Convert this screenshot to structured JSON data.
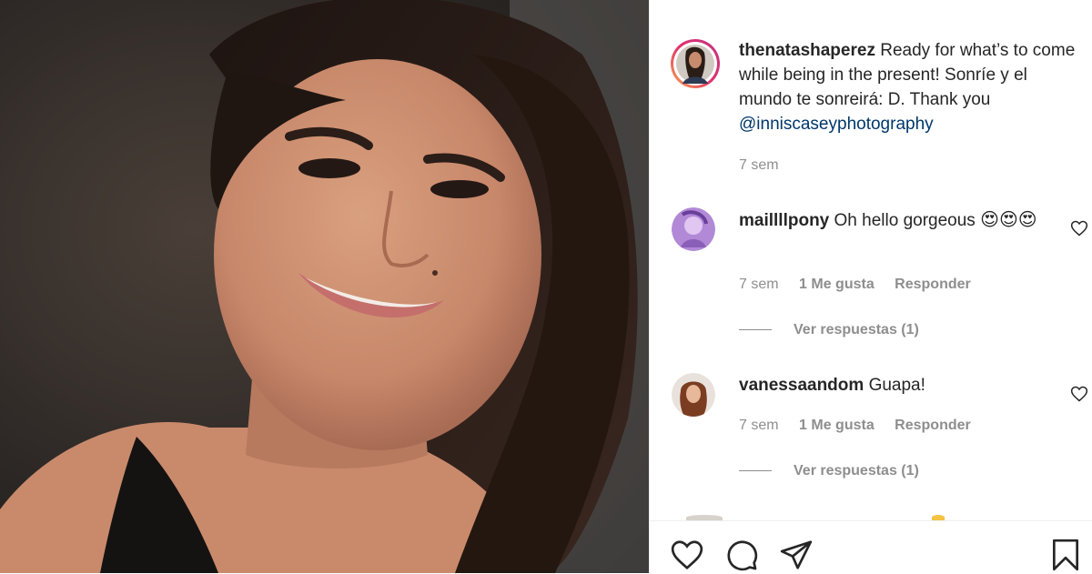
{
  "post": {
    "author": "thenatashaperez",
    "caption": "Ready for what’s to come while being in the present! Sonríe y el mundo te sonreirá: D. Thank you",
    "mention": "@inniscaseyphotography",
    "time": "7 sem"
  },
  "comments": [
    {
      "username": "maillllpony",
      "text": "Oh hello gorgeous",
      "emoji": "😍😍😍",
      "time": "7 sem",
      "likes": "1 Me gusta",
      "reply_label": "Responder",
      "view_replies": "Ver respuestas (1)"
    },
    {
      "username": "vanessaandom",
      "text": "Guapa!",
      "time": "7 sem",
      "likes": "1 Me gusta",
      "reply_label": "Responder",
      "view_replies": "Ver respuestas (1)"
    }
  ],
  "actions": [
    "heart-icon",
    "comment-icon",
    "share-icon",
    "bookmark-icon"
  ],
  "colors": {
    "mention": "#00376b",
    "muted": "#8e8e8e",
    "story_ring": "#d6249f"
  }
}
